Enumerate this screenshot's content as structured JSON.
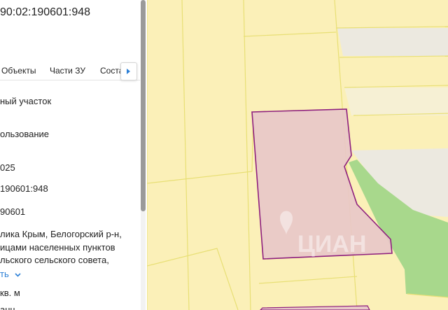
{
  "panel": {
    "title": "90:02:190601:948",
    "tabs": [
      "Объекты",
      "Части ЗУ",
      "Соста"
    ],
    "fields": [
      "ный участок",
      "ользование",
      "025",
      "190601:948",
      "90601"
    ],
    "address_lines": [
      "лика Крым, Белогорский р-н,",
      "ицами населенных пунктов",
      "льского сельского совета,"
    ],
    "show_more": "ть",
    "area": "кв. м",
    "cut_text": "анц"
  },
  "map": {
    "watermark": "ЦИАН",
    "colors": {
      "parcel_fill": "#fbf0b8",
      "parcel_border": "#e8df75",
      "highlight_fill": "#e8c8c8",
      "highlight_border": "#8e1f7e",
      "green_area": "#a8d88c",
      "road": "#ece9e0"
    }
  }
}
